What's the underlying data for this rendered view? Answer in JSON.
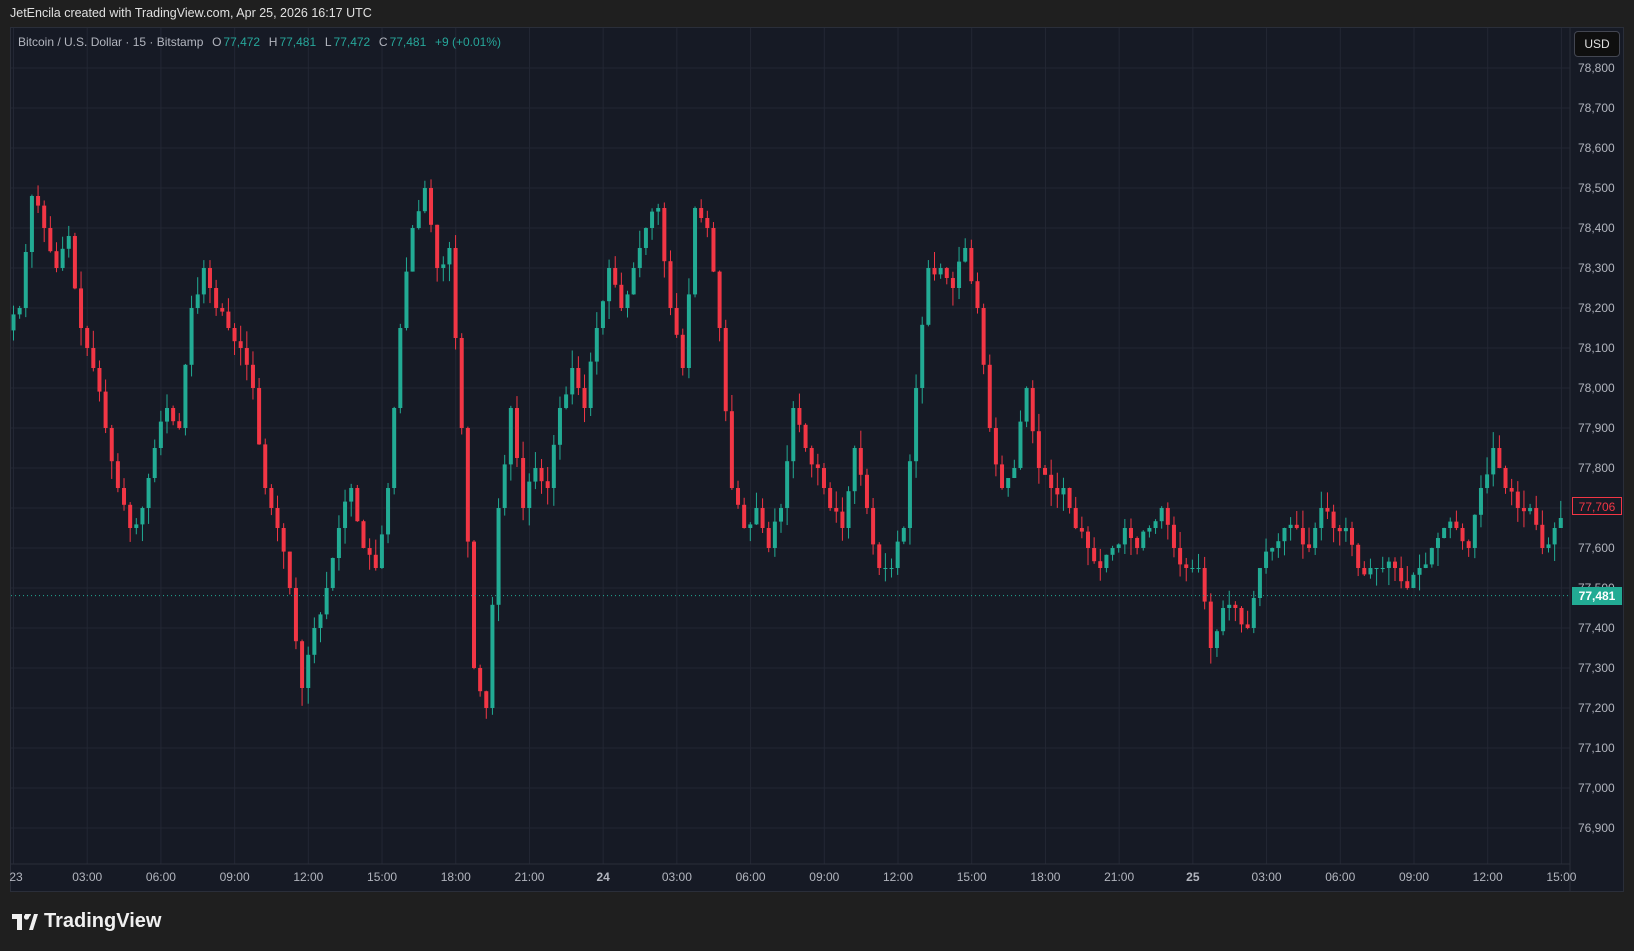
{
  "header": {
    "attribution": "JetEncila created with TradingView.com, Apr 25, 2026 16:17 UTC"
  },
  "legend": {
    "symbol": "Bitcoin / U.S. Dollar · 15 · Bitstamp",
    "o_label": "O",
    "o": "77,472",
    "h_label": "H",
    "h": "77,481",
    "l_label": "L",
    "l": "77,472",
    "c_label": "C",
    "c": "77,481",
    "change": "+9 (+0.01%)"
  },
  "currency_button": "USD",
  "price_tags": {
    "marker": "77,706",
    "last": "77,481"
  },
  "footer": {
    "logo_text": "TradingView"
  },
  "colors": {
    "up": "#22ab94",
    "down": "#f23645",
    "background": "#161a25",
    "grid": "#232734"
  },
  "chart_data": {
    "type": "candlestick",
    "title": "Bitcoin / U.S. Dollar · 15 · Bitstamp",
    "interval_minutes": 15,
    "ylim": [
      76850,
      78850
    ],
    "y_ticks": [
      "78,800",
      "78,700",
      "78,600",
      "78,500",
      "78,400",
      "78,300",
      "78,200",
      "78,100",
      "78,000",
      "77,900",
      "77,800",
      "77,700",
      "77,600",
      "77,500",
      "77,400",
      "77,300",
      "77,200",
      "77,100",
      "77,000",
      "76,900"
    ],
    "y_tick_values": [
      78800,
      78700,
      78600,
      78500,
      78400,
      78300,
      78200,
      78100,
      78000,
      77900,
      77800,
      77700,
      77600,
      77500,
      77400,
      77300,
      77200,
      77100,
      77000,
      76900
    ],
    "x_ticks": [
      "23",
      "03:00",
      "06:00",
      "09:00",
      "12:00",
      "15:00",
      "18:00",
      "21:00",
      "24",
      "03:00",
      "06:00",
      "09:00",
      "12:00",
      "15:00",
      "18:00",
      "21:00",
      "25",
      "03:00",
      "06:00",
      "09:00",
      "12:00",
      "15:00"
    ],
    "approx_closes_30m": [
      78200,
      78480,
      78400,
      78300,
      78380,
      78150,
      78050,
      77900,
      77750,
      77650,
      77700,
      77850,
      77950,
      77900,
      78200,
      78300,
      78200,
      78150,
      78100,
      78000,
      77750,
      77650,
      77500,
      77250,
      77400,
      77500,
      77650,
      77750,
      77600,
      77550,
      77750,
      78150,
      78400,
      78500,
      78300,
      78350,
      77900,
      77300,
      77200,
      77700,
      77950,
      77700,
      77800,
      77750,
      77950,
      78050,
      77950,
      78150,
      78300,
      78200,
      78300,
      78400,
      78450,
      78200,
      78050,
      78450,
      78400,
      78150,
      77750,
      77650,
      77700,
      77600,
      77700,
      77950,
      77850,
      77800,
      77700,
      77650,
      77850,
      77700,
      77550,
      77550,
      77650,
      78000,
      78300,
      78300,
      78250,
      78350,
      78200,
      77900,
      77750,
      77800,
      78000,
      77800,
      77750,
      77750,
      77650,
      77600,
      77550,
      77600,
      77650,
      77600,
      77650,
      77700,
      77600,
      77550,
      77550,
      77350,
      77450,
      77450,
      77400,
      77550,
      77600,
      77650,
      77650,
      77600,
      77700,
      77650,
      77650,
      77550,
      77550,
      77550,
      77550,
      77500,
      77550,
      77600,
      77650,
      77650,
      77600,
      77750,
      77850,
      77750,
      77700,
      77700,
      77600,
      77650,
      77700,
      77750,
      77700,
      77720,
      77706
    ],
    "last_price": 77481
  }
}
